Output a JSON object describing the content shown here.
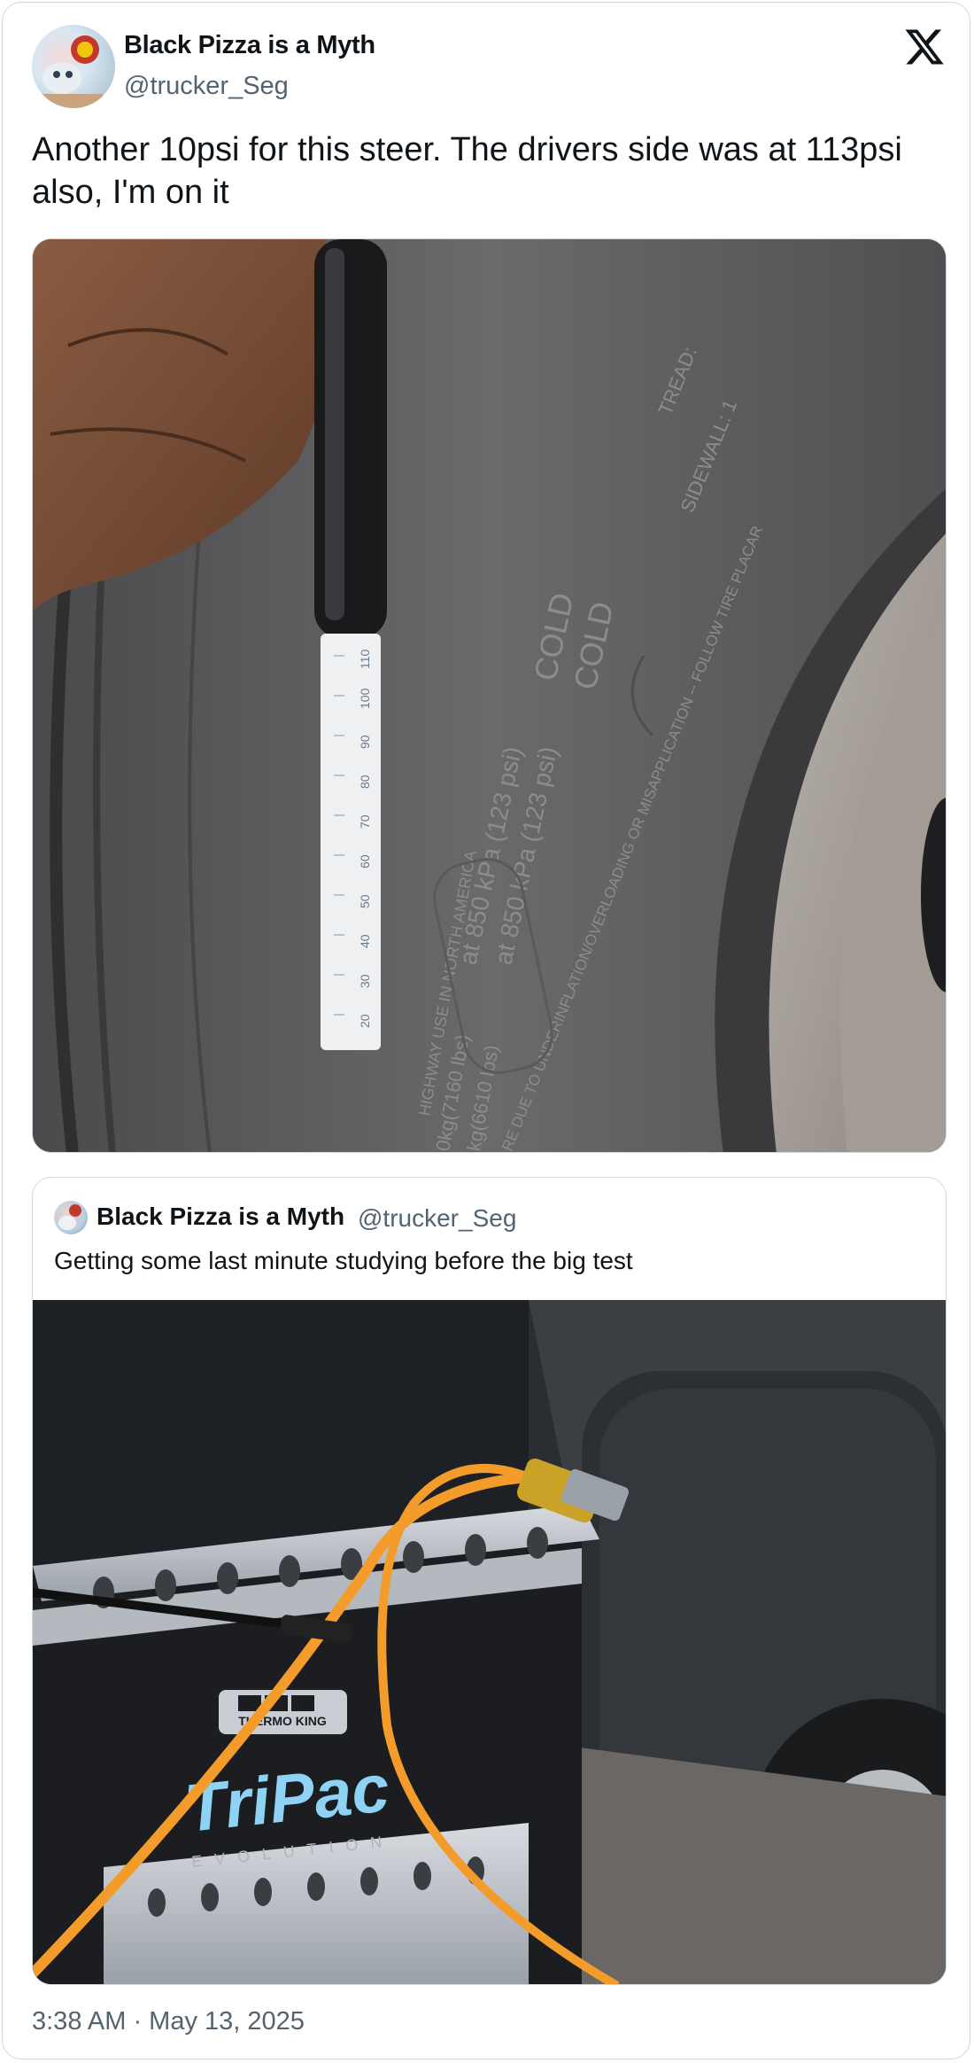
{
  "tweet": {
    "author_name": "Black Pizza is a Myth",
    "author_handle": "@trucker_Seg",
    "text": "Another 10psi for this steer. The drivers side was at 113psi also, I'm on it",
    "timestamp": "3:38 AM · May 13, 2025",
    "logo_icon": "x-logo-icon",
    "photo": {
      "gauge_scale": [
        "20",
        "30",
        "40",
        "50",
        "60",
        "70",
        "80",
        "90",
        "100",
        "110"
      ],
      "sidewall_lines": [
        "COLD",
        "COLD",
        "at 850 kPa (123 psi)",
        "at 850 kPa (123 psi)",
        "HIGHWAY USE IN NORTH AMERICA",
        "0kg(7160  lbs)",
        "kg(6610  lbs)",
        "RE DUE TO UNDERINFLATION/OVERLOADING OR MISAPPLICATION -- FOLLOW TIRE PLACAR",
        "TREAD:",
        "SIDEWALL: 1"
      ]
    }
  },
  "quoted_tweet": {
    "author_name": "Black Pizza is a Myth",
    "author_handle": "@trucker_Seg",
    "text": "Getting some last minute studying before the big test",
    "photo": {
      "brand_label": "THERMO KING",
      "product_label": "TriPac",
      "product_sublabel": "EVOLUTION"
    }
  }
}
